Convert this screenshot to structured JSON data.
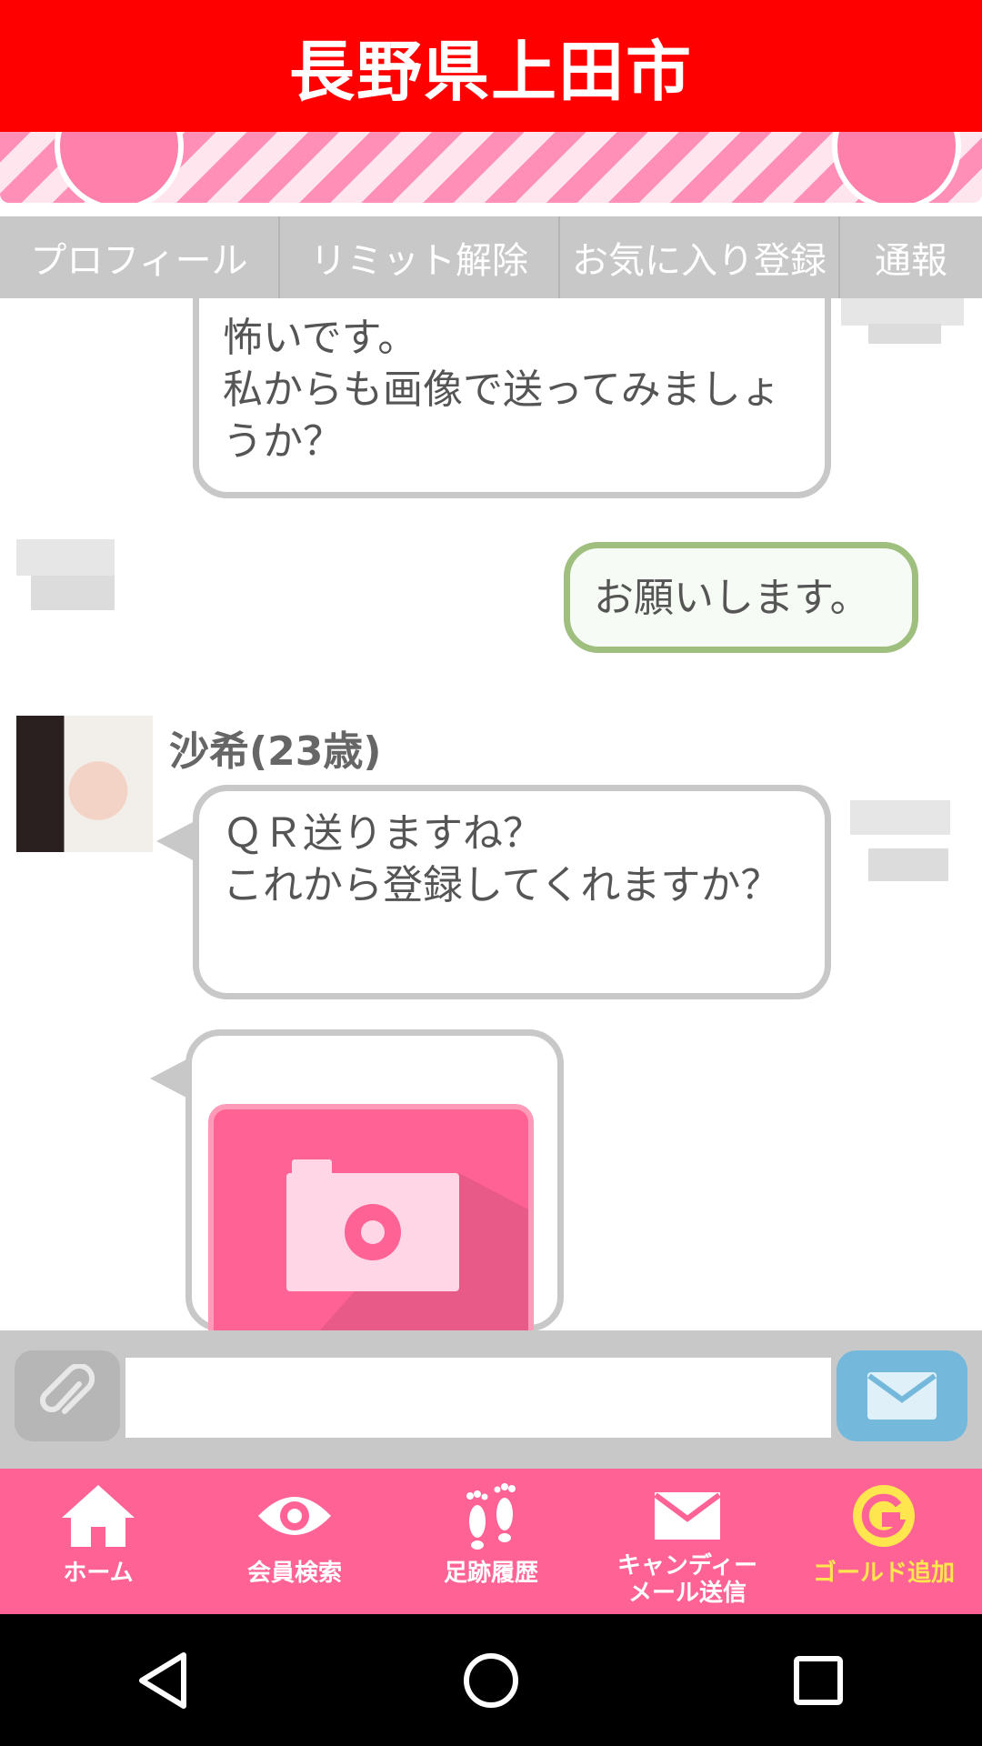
{
  "header": {
    "title": "長野県上田市"
  },
  "colors": {
    "header_red": "#ff0000",
    "nav_pink": "#ff6294",
    "gold": "#ffe64f",
    "send_blue": "#74b9dc"
  },
  "tabs": [
    {
      "label": "プロフィール"
    },
    {
      "label": "リミット解除"
    },
    {
      "label": "お気に入り登録"
    },
    {
      "label": "通報"
    }
  ],
  "messages": [
    {
      "from": "partner",
      "text": "怖いです。\n私からも画像で送ってみましょうか？"
    },
    {
      "from": "me",
      "text": "お願いします。"
    },
    {
      "from": "partner",
      "sender_name": "沙希(23歳)",
      "text": "ＱＲ送りますね？\nこれから登録してくれますか？"
    },
    {
      "from": "partner",
      "type": "image",
      "icon": "camera-icon"
    }
  ],
  "input": {
    "placeholder": ""
  },
  "bottom_nav": [
    {
      "label": "ホーム",
      "icon": "home-icon"
    },
    {
      "label": "会員検索",
      "icon": "eye-icon"
    },
    {
      "label": "足跡履歴",
      "icon": "footprints-icon"
    },
    {
      "label": "キャンディー\nメール送信",
      "icon": "mail-icon"
    },
    {
      "label": "ゴールド追加",
      "icon": "gold-g-icon"
    }
  ],
  "system_nav": [
    "back-icon",
    "home-circle-icon",
    "recents-icon"
  ]
}
